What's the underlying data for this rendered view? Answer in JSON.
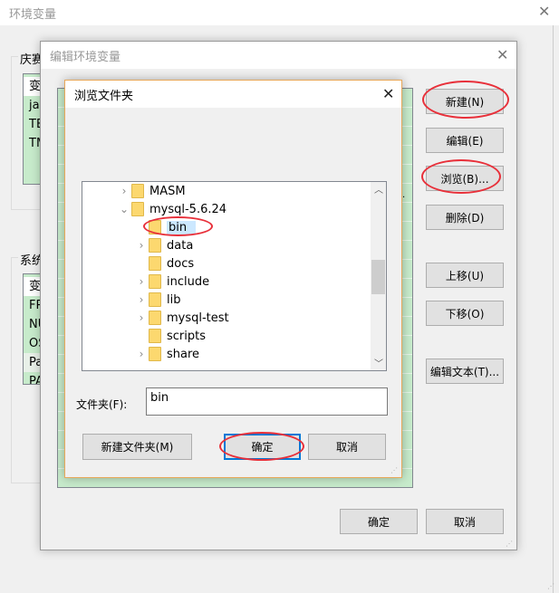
{
  "outer": {
    "title": "环境变量",
    "user_group": "庆赛",
    "system_group": "系统",
    "user_vars": [
      "变",
      "jav",
      "TE",
      "TM"
    ],
    "system_vars": [
      "变",
      "FP",
      "NU",
      "OS",
      "Pa",
      "PA"
    ]
  },
  "edit_dialog": {
    "title": "编辑环境变量",
    "buttons": {
      "new": "新建(N)",
      "edit": "编辑(E)",
      "browse": "浏览(B)...",
      "delete": "删除(D)",
      "up": "上移(U)",
      "down": "下移(O)",
      "edit_text": "编辑文本(T)..."
    },
    "ok": "确定",
    "cancel": "取消"
  },
  "browse_dialog": {
    "title": "浏览文件夹",
    "tree": [
      {
        "label": "MASM",
        "level": 0,
        "expander": "collapsed"
      },
      {
        "label": "mysql-5.6.24",
        "level": 0,
        "expander": "expanded"
      },
      {
        "label": "bin",
        "level": 1,
        "expander": "none",
        "selected": true
      },
      {
        "label": "data",
        "level": 1,
        "expander": "collapsed"
      },
      {
        "label": "docs",
        "level": 1,
        "expander": "none"
      },
      {
        "label": "include",
        "level": 1,
        "expander": "collapsed"
      },
      {
        "label": "lib",
        "level": 1,
        "expander": "collapsed"
      },
      {
        "label": "mysql-test",
        "level": 1,
        "expander": "collapsed"
      },
      {
        "label": "scripts",
        "level": 1,
        "expander": "none"
      },
      {
        "label": "share",
        "level": 1,
        "expander": "collapsed"
      }
    ],
    "folder_label": "文件夹(F):",
    "folder_value": "bin",
    "new_folder": "新建文件夹(M)",
    "ok": "确定",
    "cancel": "取消"
  },
  "colors": {
    "annotation": "#e8303a",
    "list_bg": "#c7ebcb",
    "focus": "#0078d7"
  }
}
